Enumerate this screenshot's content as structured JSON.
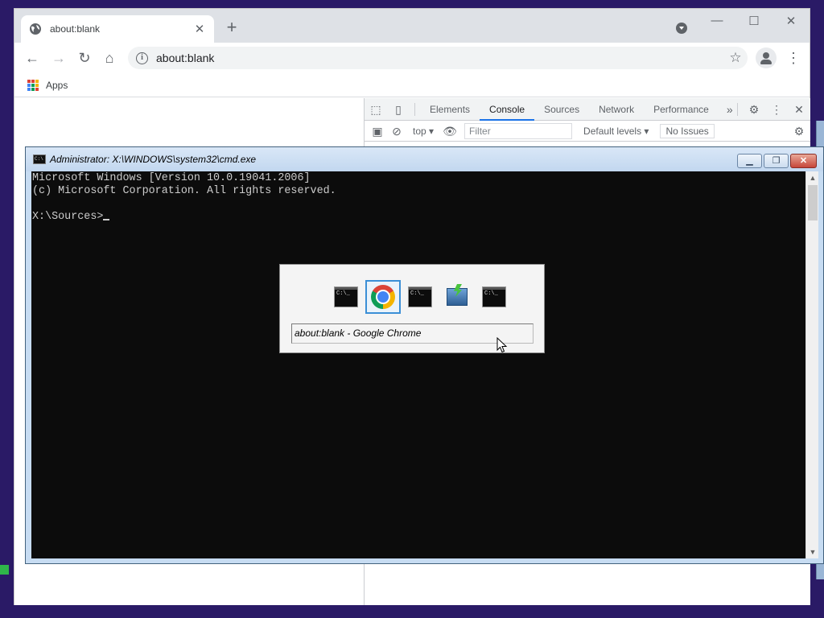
{
  "chrome": {
    "tab_title": "about:blank",
    "url": "about:blank",
    "bookmarks_apps_label": "Apps"
  },
  "devtools": {
    "tabs": [
      "Elements",
      "Console",
      "Sources",
      "Network",
      "Performance"
    ],
    "active_tab": "Console",
    "more_tabs_label": "»",
    "context": "top",
    "filter_placeholder": "Filter",
    "levels": "Default levels",
    "issues": "No Issues"
  },
  "cmd": {
    "title": "Administrator: X:\\WINDOWS\\system32\\cmd.exe",
    "lines": [
      "Microsoft Windows [Version 10.0.19041.2006]",
      "(c) Microsoft Corporation. All rights reserved.",
      "",
      "X:\\Sources>"
    ]
  },
  "switcher": {
    "apps": [
      "cmd",
      "chrome",
      "cmd",
      "setup",
      "cmd"
    ],
    "selected_index": 1,
    "cmd_icon_text": "C:\\_",
    "label": "about:blank - Google Chrome"
  },
  "colors": {
    "desktop": "#2a1a66",
    "console_bg": "#0c0c0c",
    "console_fg": "#cccccc",
    "selection": "#3b8fd6"
  }
}
